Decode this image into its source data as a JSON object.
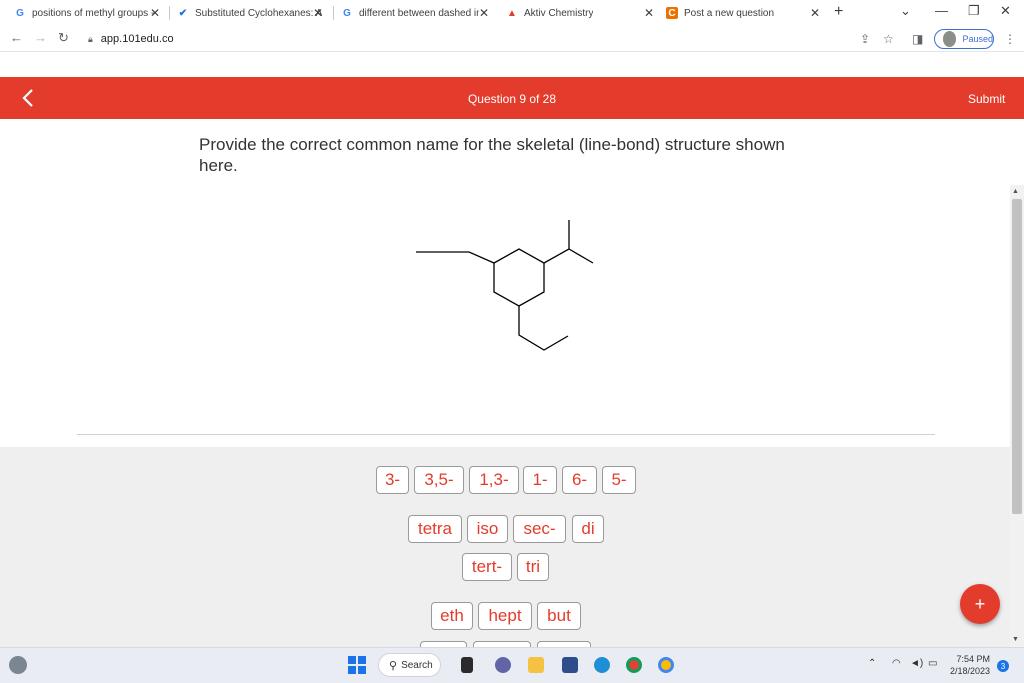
{
  "browser": {
    "tabs": [
      {
        "title": "positions of methyl groups -",
        "favicon": "google-icon"
      },
      {
        "title": "Substituted Cyclohexanes: A",
        "favicon": "check-icon"
      },
      {
        "title": "different between dashed ine",
        "favicon": "google-icon"
      },
      {
        "title": "Aktiv Chemistry",
        "favicon": "aktiv-icon"
      },
      {
        "title": "Post a new question",
        "favicon": "chegg-icon"
      }
    ],
    "url": "app.101edu.co",
    "profile_status": "Paused"
  },
  "header": {
    "question_counter": "Question 9 of 28",
    "submit_label": "Submit"
  },
  "question": {
    "prompt": "Provide the correct common name for the skeletal (line-bond) structure shown here."
  },
  "tiles": {
    "row1": [
      "3-",
      "3,5-",
      "1,3-",
      "1-",
      "6-",
      "5-"
    ],
    "row2": [
      "tetra",
      "iso",
      "sec-",
      "di"
    ],
    "row3": [
      "tert-",
      "tri"
    ],
    "row4": [
      "eth",
      "hept",
      "but"
    ]
  },
  "fab_label": "+",
  "taskbar": {
    "search_label": "Search",
    "time": "7:54 PM",
    "date": "2/18/2023",
    "notification_count": "3"
  },
  "colors": {
    "accent": "#e43c2c",
    "tile_text": "#e43c2c",
    "answer_bg": "#efefef"
  }
}
